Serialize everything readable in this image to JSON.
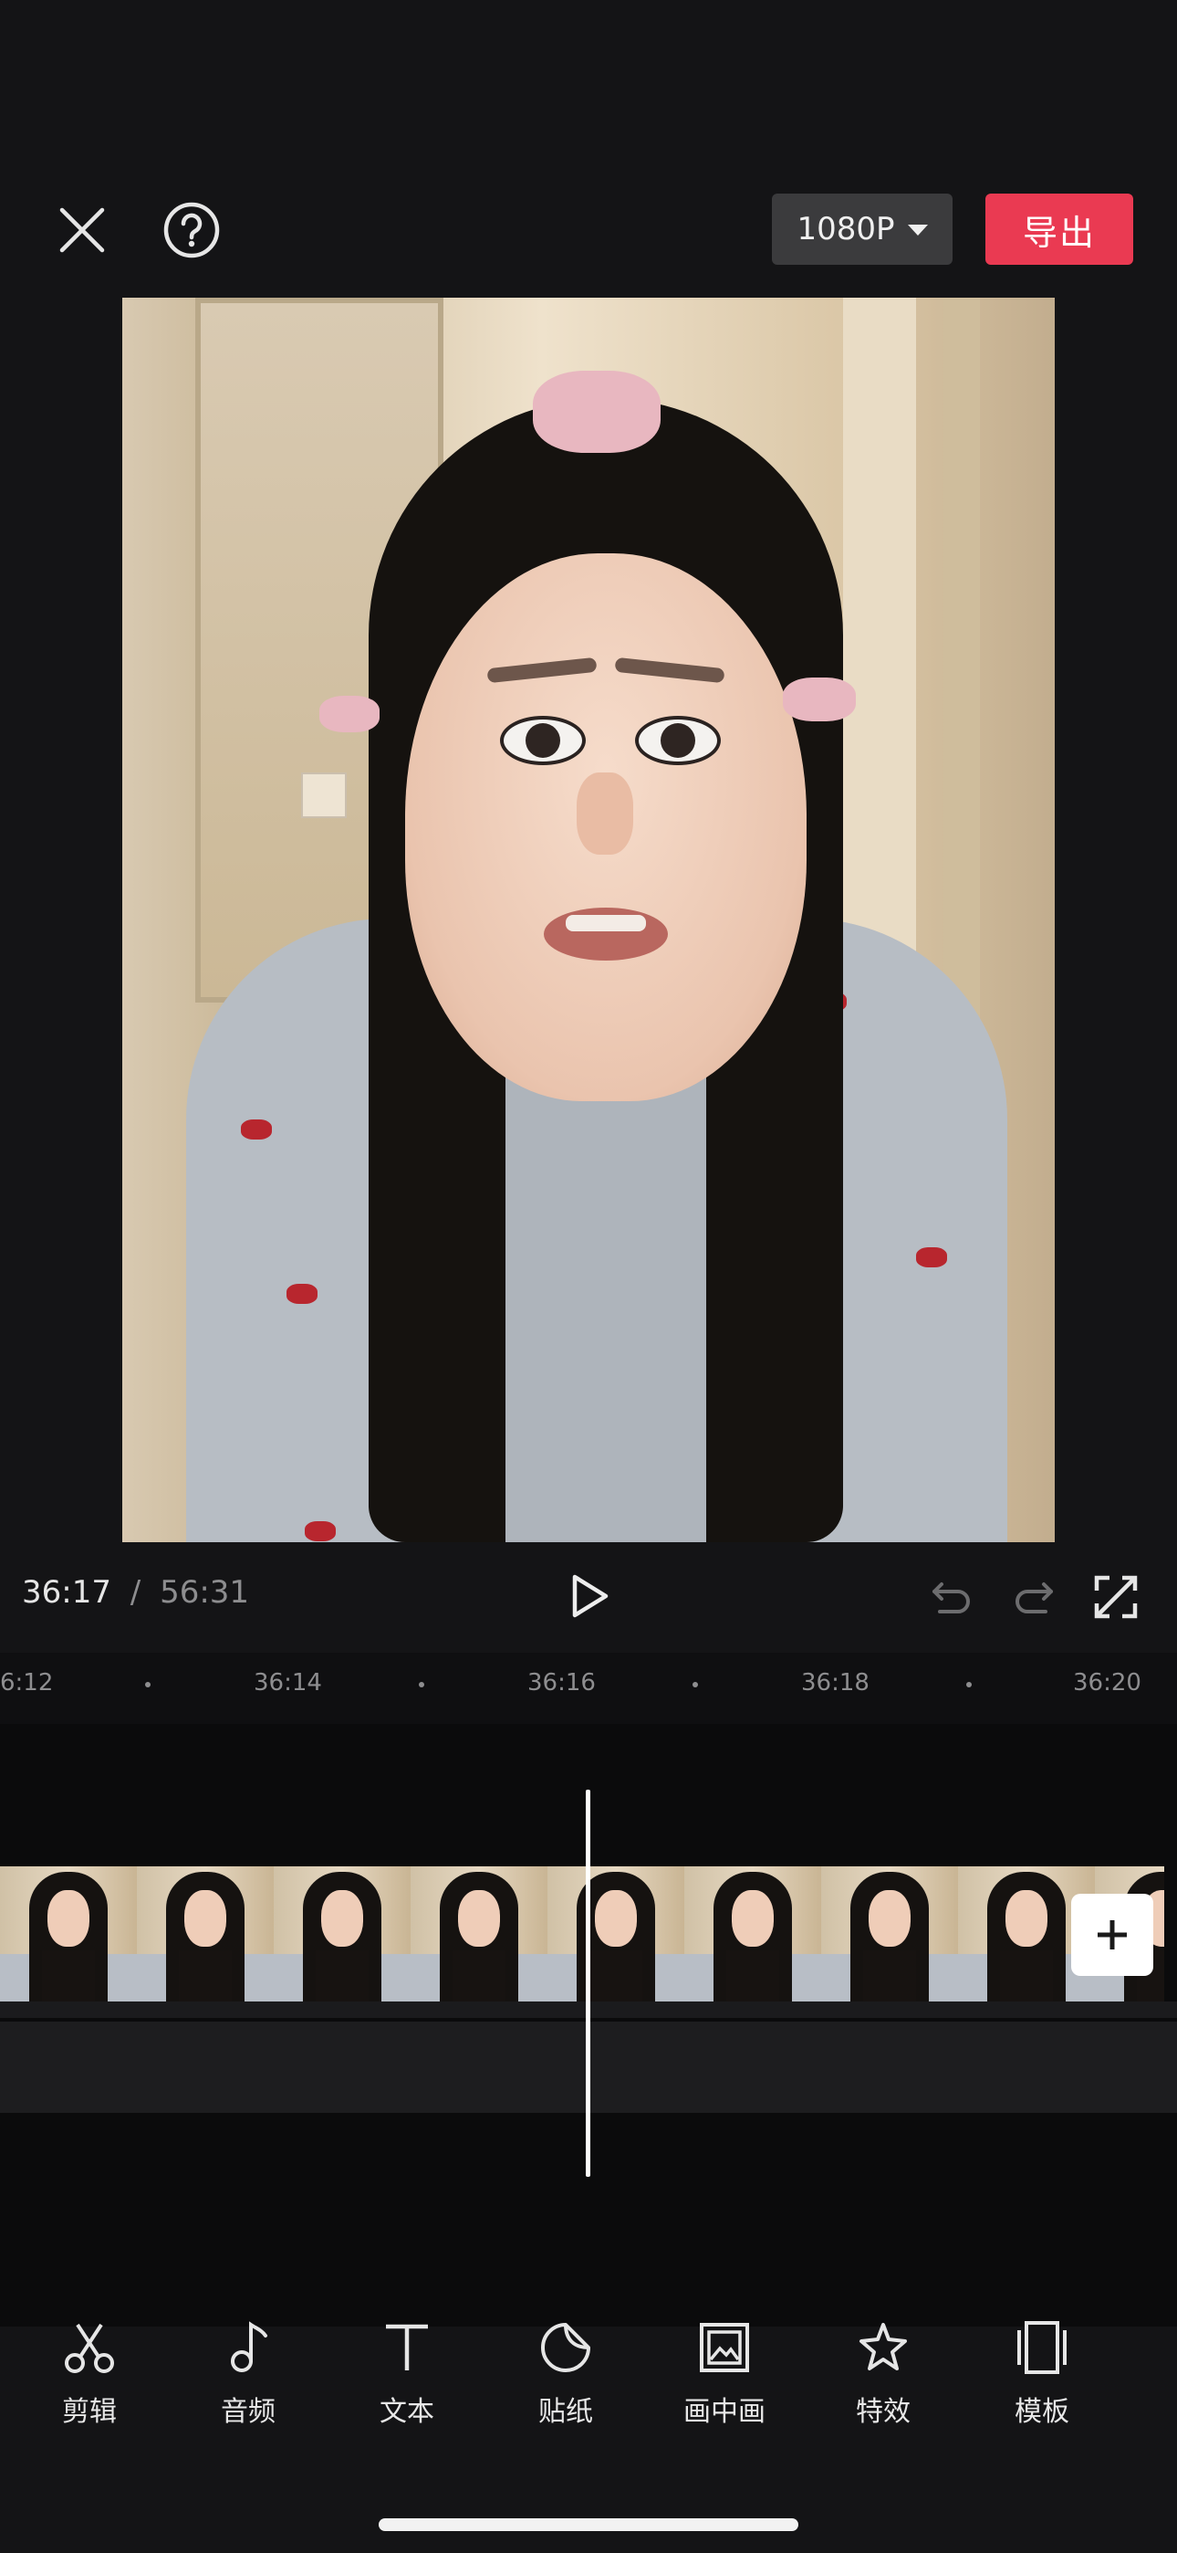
{
  "header": {
    "resolution_label": "1080P",
    "export_label": "导出",
    "close_icon": "close-icon",
    "help_icon": "help-icon"
  },
  "playback": {
    "current_time": "36:17",
    "separator": "/",
    "total_time": "56:31"
  },
  "timeline": {
    "ruler_labels": [
      "6:12",
      "36:14",
      "36:16",
      "36:18",
      "36:20"
    ],
    "frame_count": 9
  },
  "toolbar": {
    "items": [
      {
        "label": "剪辑",
        "icon": "scissors-icon"
      },
      {
        "label": "音频",
        "icon": "music-note-icon"
      },
      {
        "label": "文本",
        "icon": "text-icon"
      },
      {
        "label": "贴纸",
        "icon": "sticker-icon"
      },
      {
        "label": "画中画",
        "icon": "picture-in-picture-icon"
      },
      {
        "label": "特效",
        "icon": "effects-star-icon"
      },
      {
        "label": "模板",
        "icon": "template-icon"
      }
    ]
  },
  "colors": {
    "background": "#141416",
    "export_button": "#ea3a52",
    "resolution_button": "#3b3b3d",
    "playhead": "#ffffff"
  }
}
